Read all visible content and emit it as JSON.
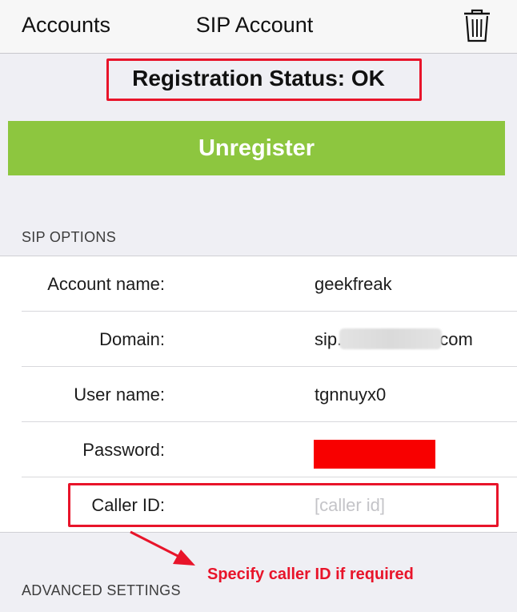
{
  "navbar": {
    "back_label": "Accounts",
    "title": "SIP Account",
    "delete_icon": "trash-icon"
  },
  "status": {
    "text": "Registration Status: OK"
  },
  "unregister_label": "Unregister",
  "sections": {
    "sip_options": "SIP OPTIONS",
    "advanced_settings": "ADVANCED SETTINGS"
  },
  "fields": [
    {
      "label": "Account name:",
      "value": "geekfreak"
    },
    {
      "label": "Domain:",
      "value_prefix": "sip.",
      "value_suffix": "com",
      "note": "middle part redacted"
    },
    {
      "label": "User name:",
      "value": "tgnnuyx0"
    },
    {
      "label": "Password:",
      "value": "",
      "note": "redacted"
    },
    {
      "label": "Caller ID:",
      "value": "",
      "placeholder": "[caller id]"
    }
  ],
  "annotation": {
    "text": "Specify caller ID if required",
    "color": "#e8142a"
  },
  "colors": {
    "accent_green": "#8dc63f",
    "highlight_red": "#e8142a",
    "background": "#efeff4"
  }
}
